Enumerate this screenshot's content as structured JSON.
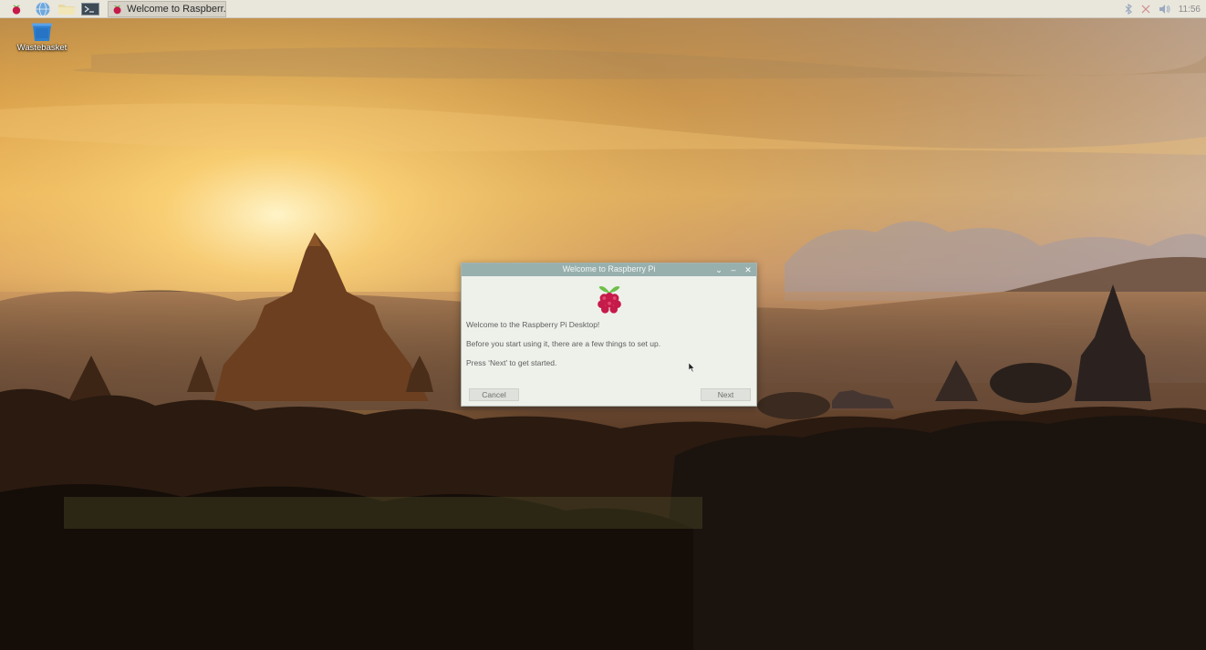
{
  "taskbar": {
    "launchers": [
      {
        "name": "menu",
        "icon": "raspberry-icon"
      },
      {
        "name": "web-browser",
        "icon": "globe-icon"
      },
      {
        "name": "file-manager",
        "icon": "folder-icon"
      },
      {
        "name": "terminal",
        "icon": "terminal-icon"
      }
    ],
    "task": {
      "label": "Welcome to Raspberr...",
      "icon": "raspberry-icon"
    },
    "tray": {
      "icons": [
        "bluetooth-icon",
        "network-icon",
        "volume-icon"
      ],
      "clock": "11:56"
    }
  },
  "desktop": {
    "icons": [
      {
        "label": "Wastebasket",
        "icon": "wastebasket-icon"
      }
    ]
  },
  "dialog": {
    "title": "Welcome to Raspberry Pi",
    "controls": {
      "minimize": "⌄",
      "maximize": "–",
      "close": "✕"
    },
    "line1": "Welcome to the Raspberry Pi Desktop!",
    "line2": "Before you start using it, there are a few things to set up.",
    "line3": "Press ‘Next’ to get started.",
    "cancel_label": "Cancel",
    "next_label": "Next"
  },
  "colors": {
    "taskbar": "#e9e6dc",
    "dialog_titlebar": "#97b0ae",
    "dialog_bg": "#eef0ea",
    "raspberry_red": "#c51a4a",
    "raspberry_leaf": "#6cc04a"
  }
}
